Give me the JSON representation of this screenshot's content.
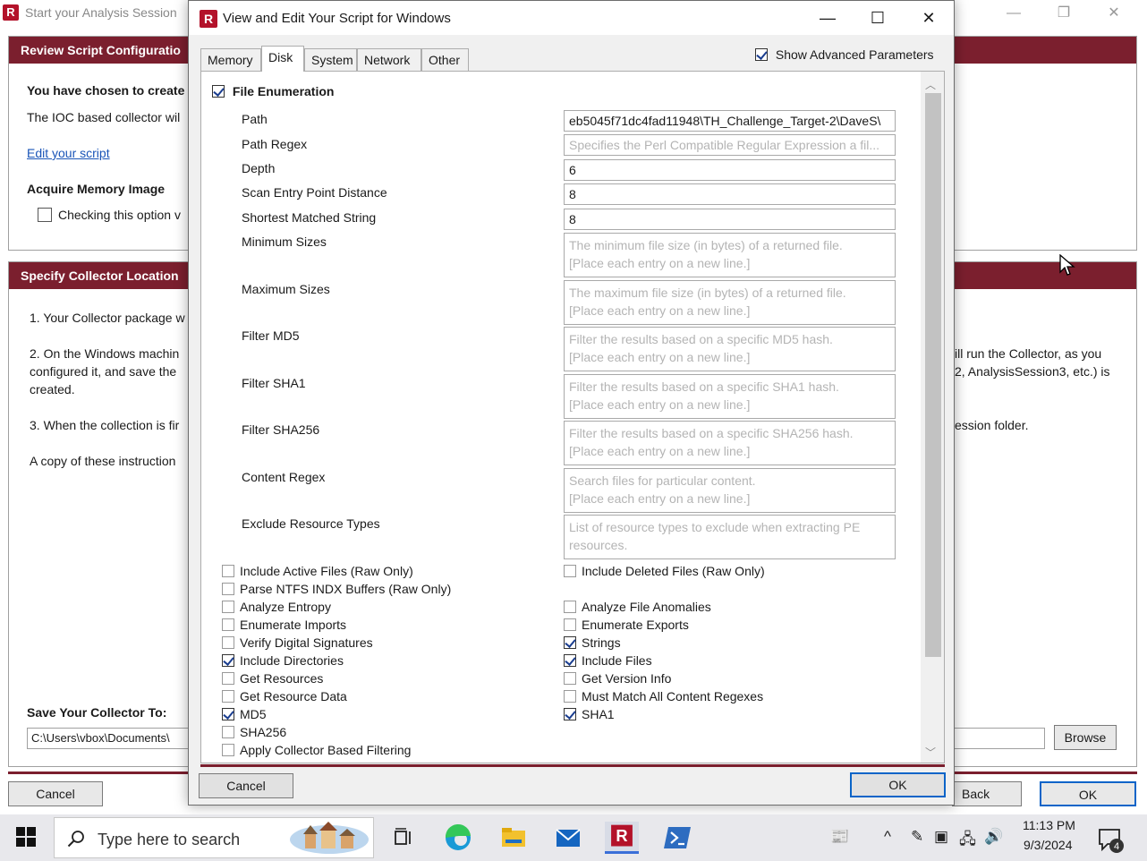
{
  "background_window": {
    "title": "Start your Analysis Session",
    "panel1": {
      "header": "Review Script Configuratio",
      "chosen_text": "You have chosen to create",
      "ioc_text": "The IOC based collector wil",
      "edit_link": "Edit your script",
      "acquire_heading": "Acquire Memory Image",
      "checking_text": "Checking this option v"
    },
    "panel2": {
      "header": "Specify Collector Location",
      "step1": "1. Your Collector package w",
      "step2_line1": "2. On the Windows machin",
      "step2_line2": "configured it, and save the",
      "step2_line3": "created.",
      "step2_right1": "ill run the Collector, as you",
      "step2_right2": "2, AnalysisSession3, etc.) is",
      "step3": "3. When the collection is fir",
      "step3_right": "ession folder.",
      "copy_text": "A copy of these instruction",
      "save_heading": "Save Your Collector To:",
      "save_path": "C:\\Users\\vbox\\Documents\\",
      "browse": "Browse"
    },
    "buttons": {
      "cancel": "Cancel",
      "back": "Back",
      "ok": "OK"
    }
  },
  "dialog": {
    "title": "View and Edit Your Script for Windows",
    "tabs": [
      {
        "label": "Memory",
        "active": false
      },
      {
        "label": "Disk",
        "active": true
      },
      {
        "label": "System",
        "active": false
      },
      {
        "label": "Network",
        "active": false
      },
      {
        "label": "Other",
        "active": false
      }
    ],
    "show_advanced": {
      "label": "Show Advanced Parameters",
      "checked": true
    },
    "file_enumeration": {
      "label": "File Enumeration",
      "checked": true
    },
    "fields": {
      "path": {
        "label": "Path",
        "value": "eb5045f71dc4fad11948\\TH_Challenge_Target-2\\DaveS\\"
      },
      "path_regex": {
        "label": "Path Regex",
        "placeholder": "Specifies the Perl Compatible Regular Expression a fil..."
      },
      "depth": {
        "label": "Depth",
        "value": "6"
      },
      "scan_entry": {
        "label": "Scan Entry Point Distance",
        "value": "8"
      },
      "shortest": {
        "label": "Shortest Matched String",
        "value": "8"
      },
      "min_sizes": {
        "label": "Minimum Sizes",
        "placeholder1": "The minimum file size (in bytes) of a returned file.",
        "placeholder2": "[Place each entry on a new line.]"
      },
      "max_sizes": {
        "label": "Maximum Sizes",
        "placeholder1": "The maximum file size (in bytes) of a returned file.",
        "placeholder2": "[Place each entry on a new line.]"
      },
      "filter_md5": {
        "label": "Filter MD5",
        "placeholder1": "Filter the results based on a specific MD5 hash.",
        "placeholder2": "[Place each entry on a new line.]"
      },
      "filter_sha1": {
        "label": "Filter SHA1",
        "placeholder1": "Filter the results based on a specific SHA1 hash.",
        "placeholder2": "[Place each entry on a new line.]"
      },
      "filter_sha256": {
        "label": "Filter SHA256",
        "placeholder1": "Filter the results based on a specific SHA256 hash.",
        "placeholder2": "[Place each entry on a new line.]"
      },
      "content_regex": {
        "label": "Content Regex",
        "placeholder1": "Search files for particular content.",
        "placeholder2": "[Place each entry on a new line.]"
      },
      "exclude_types": {
        "label": "Exclude Resource Types",
        "placeholder1": "List of resource types to exclude when extracting PE",
        "placeholder2": "resources."
      }
    },
    "options_left": [
      {
        "label": "Include Active Files (Raw Only)",
        "checked": false
      },
      {
        "label": "Parse NTFS INDX Buffers (Raw Only)",
        "checked": false
      },
      {
        "label": "Analyze Entropy",
        "checked": false
      },
      {
        "label": "Enumerate Imports",
        "checked": false
      },
      {
        "label": "Verify Digital Signatures",
        "checked": false
      },
      {
        "label": "Include Directories",
        "checked": true
      },
      {
        "label": "Get Resources",
        "checked": false
      },
      {
        "label": "Get Resource Data",
        "checked": false
      },
      {
        "label": "MD5",
        "checked": true
      },
      {
        "label": "SHA256",
        "checked": false
      },
      {
        "label": "Apply Collector Based Filtering",
        "checked": false
      }
    ],
    "options_right": [
      {
        "label": "Include Deleted Files (Raw Only)",
        "checked": false
      },
      {
        "label": "Analyze File Anomalies",
        "checked": false
      },
      {
        "label": "Enumerate Exports",
        "checked": false
      },
      {
        "label": "Strings",
        "checked": true
      },
      {
        "label": "Include Files",
        "checked": true
      },
      {
        "label": "Get Version Info",
        "checked": false
      },
      {
        "label": "Must Match All Content Regexes",
        "checked": false
      },
      {
        "label": "SHA1",
        "checked": true
      }
    ],
    "cancel": "Cancel",
    "ok": "OK"
  },
  "taskbar": {
    "search_placeholder": "Type here to search",
    "time": "11:13 PM",
    "date": "9/3/2024",
    "notification_count": "4"
  },
  "colors": {
    "accent": "#7b1f2e",
    "brand": "#b3122a",
    "focus": "#0a64c8",
    "link": "#1a55b8"
  }
}
